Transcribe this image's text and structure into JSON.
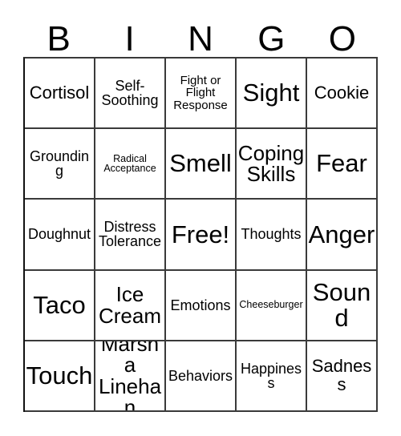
{
  "card": {
    "title_letters": [
      "B",
      "I",
      "N",
      "G",
      "O"
    ],
    "columns": 5,
    "rows": 5,
    "border_color": "#3a3a3a",
    "background_color": "#ffffff",
    "text_color": "#000000",
    "free_space": "Free!",
    "cells": [
      {
        "text": "Cortisol",
        "size": "l"
      },
      {
        "text": "Self-Soothing",
        "size": "m"
      },
      {
        "text": "Fight or Flight Response",
        "size": "s"
      },
      {
        "text": "Sight",
        "size": "xxl"
      },
      {
        "text": "Cookie",
        "size": "l"
      },
      {
        "text": "Grounding",
        "size": "m"
      },
      {
        "text": "Radical Acceptance",
        "size": "xs"
      },
      {
        "text": "Smell",
        "size": "xxl"
      },
      {
        "text": "Coping Skills",
        "size": "xl"
      },
      {
        "text": "Fear",
        "size": "xxl"
      },
      {
        "text": "Doughnut",
        "size": "m"
      },
      {
        "text": "Distress Tolerance",
        "size": "m"
      },
      {
        "text": "Free!",
        "size": "xxl"
      },
      {
        "text": "Thoughts",
        "size": "m"
      },
      {
        "text": "Anger",
        "size": "xxl"
      },
      {
        "text": "Taco",
        "size": "xxl"
      },
      {
        "text": "Ice Cream",
        "size": "xl"
      },
      {
        "text": "Emotions",
        "size": "m"
      },
      {
        "text": "Cheeseburger",
        "size": "xs"
      },
      {
        "text": "Sound",
        "size": "xxl"
      },
      {
        "text": "Touch",
        "size": "xxl"
      },
      {
        "text": "Marsha Linehan",
        "size": "xl"
      },
      {
        "text": "Behaviors",
        "size": "m"
      },
      {
        "text": "Happiness",
        "size": "m"
      },
      {
        "text": "Sadness",
        "size": "l"
      }
    ]
  }
}
